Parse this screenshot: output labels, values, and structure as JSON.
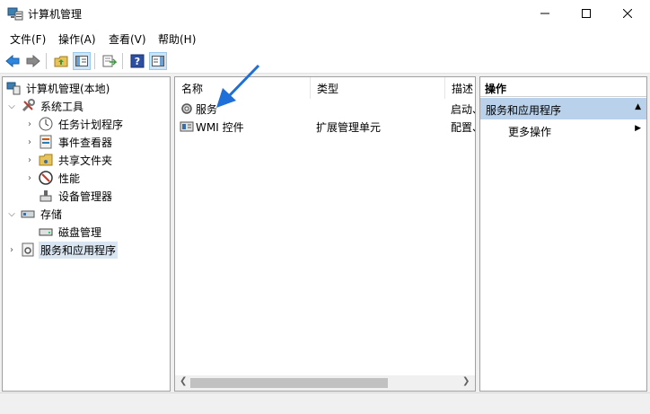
{
  "window": {
    "title": "计算机管理"
  },
  "menu": [
    "文件(F)",
    "操作(A)",
    "查看(V)",
    "帮助(H)"
  ],
  "toolbar": [
    "back-icon",
    "forward-icon",
    "up-folder-icon",
    "show-tree-icon",
    "export-list-icon",
    "help-icon",
    "action-pane-icon"
  ],
  "tree": {
    "root": "计算机管理(本地)",
    "system_tools": "系统工具",
    "task_scheduler": "任务计划程序",
    "event_viewer": "事件查看器",
    "shared_folders": "共享文件夹",
    "performance": "性能",
    "device_manager": "设备管理器",
    "storage": "存储",
    "disk_management": "磁盘管理",
    "services_apps": "服务和应用程序"
  },
  "list": {
    "columns": [
      "名称",
      "类型",
      "描述"
    ],
    "rows": [
      {
        "name": "服务",
        "type": "",
        "desc": "启动、"
      },
      {
        "name": "WMI 控件",
        "type": "扩展管理单元",
        "desc": "配置、"
      }
    ]
  },
  "actions": {
    "title": "操作",
    "group": "服务和应用程序",
    "more": "更多操作"
  },
  "colors": {
    "selection": "#d9e6f2",
    "action_group": "#b9d1ea",
    "annotation_arrow": "#1e6fd9"
  }
}
